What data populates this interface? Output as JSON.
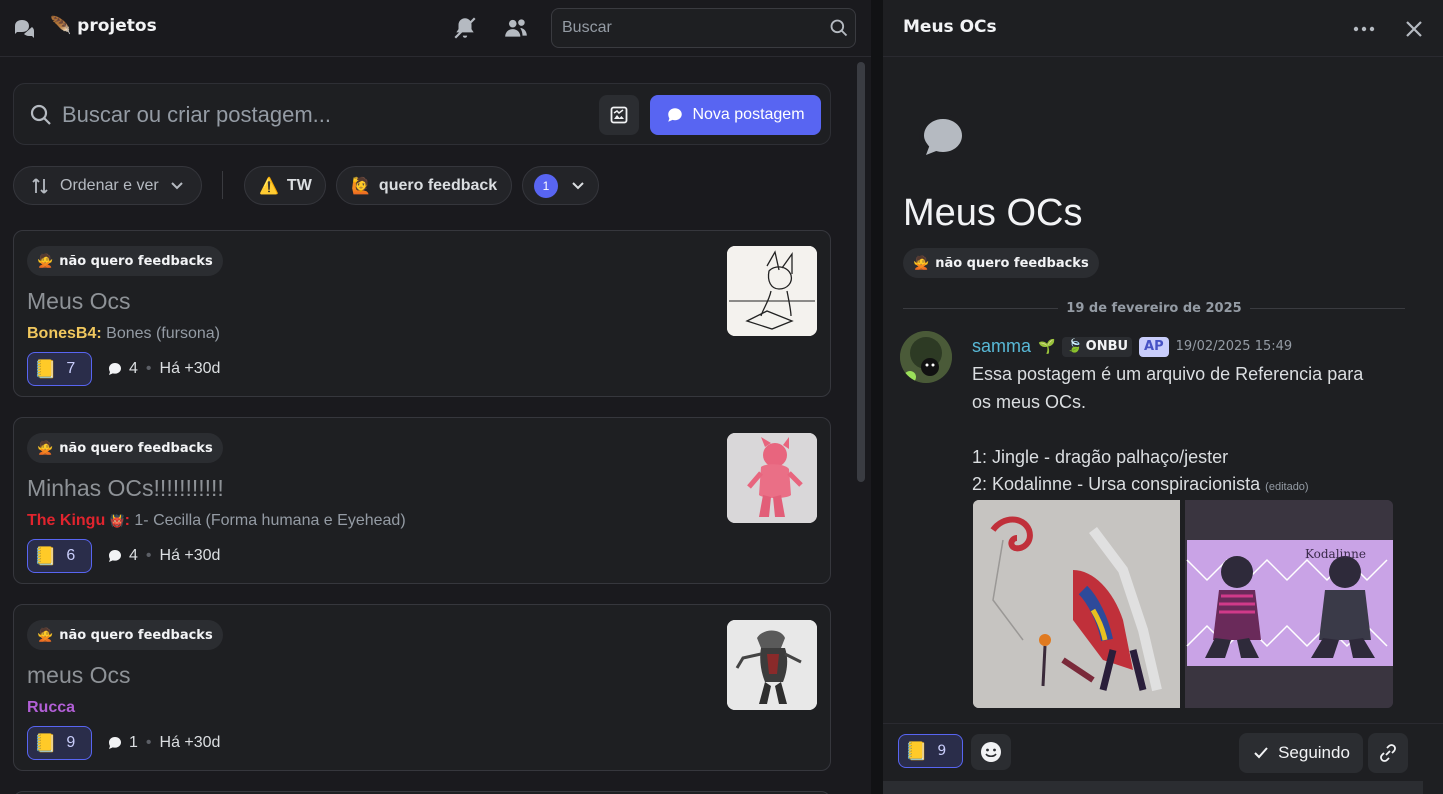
{
  "channel": {
    "name": "projetos",
    "leaf_emoji": "🪶"
  },
  "topbar": {
    "search_placeholder": "Buscar"
  },
  "posts_toolbar": {
    "search_placeholder": "Buscar ou criar postagem...",
    "new_post_label": "Nova postagem"
  },
  "filters": {
    "sort_label": "Ordenar e ver",
    "tw": {
      "emoji": "⚠️",
      "label": "TW"
    },
    "feedback": {
      "emoji": "🙋",
      "label": "quero feedback"
    },
    "count": "1"
  },
  "posts": [
    {
      "tag_emoji": "🙅",
      "tag": "não quero feedbacks",
      "title": "Meus Ocs",
      "author": "BonesB4",
      "author_color": "#f0c75e",
      "author_suffix": "",
      "preview": "Bones (fursona)",
      "reaction_emoji": "📒",
      "reaction_count": "7",
      "messages": "4",
      "age": "Há +30d"
    },
    {
      "tag_emoji": "🙅",
      "tag": "não quero feedbacks",
      "title": "Minhas OCs!!!!!!!!!!!",
      "author": "The Kingu",
      "author_color": "#e0242e",
      "author_suffix": "👹",
      "preview": "1- Cecilla (Forma humana e Eyehead)",
      "reaction_emoji": "📒",
      "reaction_count": "6",
      "messages": "4",
      "age": "Há +30d"
    },
    {
      "tag_emoji": "🙅",
      "tag": "não quero feedbacks",
      "title": "meus Ocs",
      "author": "Rucca",
      "author_color": "#b25fd6",
      "author_suffix": "",
      "preview": "",
      "reaction_emoji": "📒",
      "reaction_count": "9",
      "messages": "1",
      "age": "Há +30d"
    }
  ],
  "thread": {
    "header_title": "Meus OCs",
    "title": "Meus OCs",
    "tag_emoji": "🙅",
    "tag": "não quero feedbacks",
    "date_divider": "19 de fevereiro de 2025",
    "message": {
      "username": "samma",
      "username_emoji": "🌱",
      "guild_emoji": "🍃",
      "guild_tag": "ONBU",
      "role_tag": "AP",
      "timestamp": "19/02/2025 15:49",
      "line1": "Essa postagem é um arquivo de Referencia para",
      "line2": "os meus OCs.",
      "line3": "1: Jingle - dragão palhaço/jester",
      "line4": "2: Kodalinne - Ursa conspiracionista",
      "edited": "(editado)"
    },
    "attachment2_caption": "Kodalinne"
  },
  "thread_footer": {
    "reaction_emoji": "📒",
    "reaction_count": "9",
    "follow_label": "Seguindo"
  }
}
